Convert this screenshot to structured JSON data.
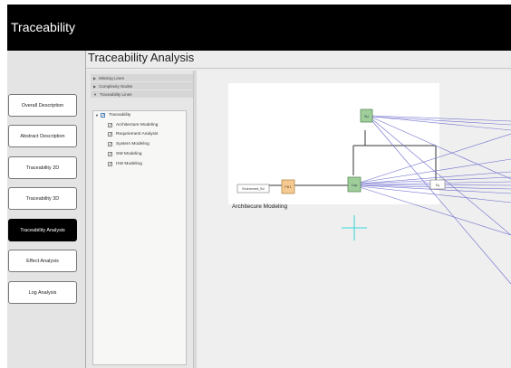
{
  "app": {
    "title": "Traceability"
  },
  "page": {
    "title": "Traceability Analysis"
  },
  "nav": {
    "items": [
      {
        "label": "Overall Description"
      },
      {
        "label": "Abstract Description"
      },
      {
        "label": "Traceability 2D"
      },
      {
        "label": "Traceability 3D"
      },
      {
        "label": "Traceability Analysis",
        "active": true
      },
      {
        "label": "Effect Analysis"
      },
      {
        "label": "Log Analysis"
      }
    ]
  },
  "accordion": {
    "items": [
      {
        "label": "Missing Lines",
        "expanded": false
      },
      {
        "label": "Complexity Nodes",
        "expanded": false
      },
      {
        "label": "Traceability Lines",
        "expanded": true
      }
    ]
  },
  "tree": {
    "root": {
      "label": "Traceability",
      "checked": true
    },
    "children": [
      {
        "label": "Architecture Modeling",
        "checked": true
      },
      {
        "label": "Requriement Analysis",
        "checked": true
      },
      {
        "label": "System Modeling",
        "checked": true
      },
      {
        "label": "SW Modeling",
        "checked": true
      },
      {
        "label": "HW Modeling",
        "checked": true
      }
    ]
  },
  "diagram": {
    "caption": "Architecure Modeling",
    "nodes": {
      "environment": "Environment_Sol",
      "component": "F.B.1",
      "top": "SU",
      "center": "Cmp",
      "right": "Eq"
    },
    "colors": {
      "green_node": "#9fce9b",
      "orange_node": "#f5c990",
      "trace_line": "#6d6dcf",
      "crosshair": "#34d7d7"
    }
  }
}
